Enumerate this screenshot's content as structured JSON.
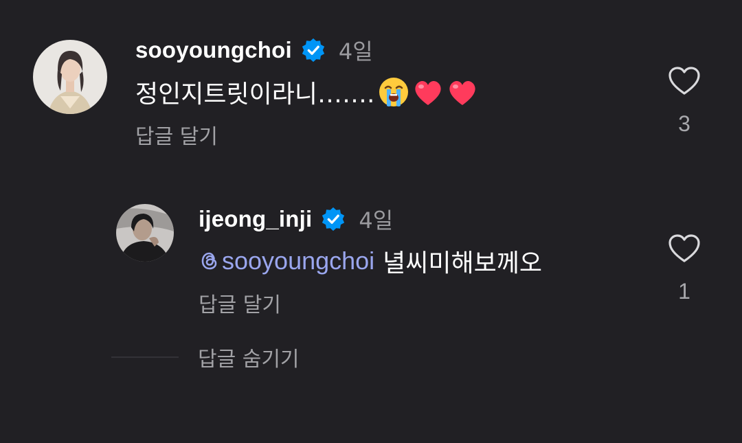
{
  "comments": [
    {
      "username": "sooyoungchoi",
      "verified": true,
      "time": "4일",
      "text": "정인지트릿이라니…….",
      "emojis": [
        "loudly-crying-face",
        "red-heart",
        "red-heart"
      ],
      "reply_label": "답글 달기",
      "like_count": "3"
    },
    {
      "username": "ijeong_inji",
      "verified": true,
      "time": "4일",
      "mention": "sooyoungchoi",
      "text": "녈씨미해보께오",
      "reply_label": "답글 달기",
      "like_count": "1"
    }
  ],
  "hide_replies_label": "답글 숨기기",
  "colors": {
    "background": "#212024",
    "verified": "#0095f6",
    "mention": "#9aa6ee",
    "secondary_text": "#a2a2a6"
  }
}
